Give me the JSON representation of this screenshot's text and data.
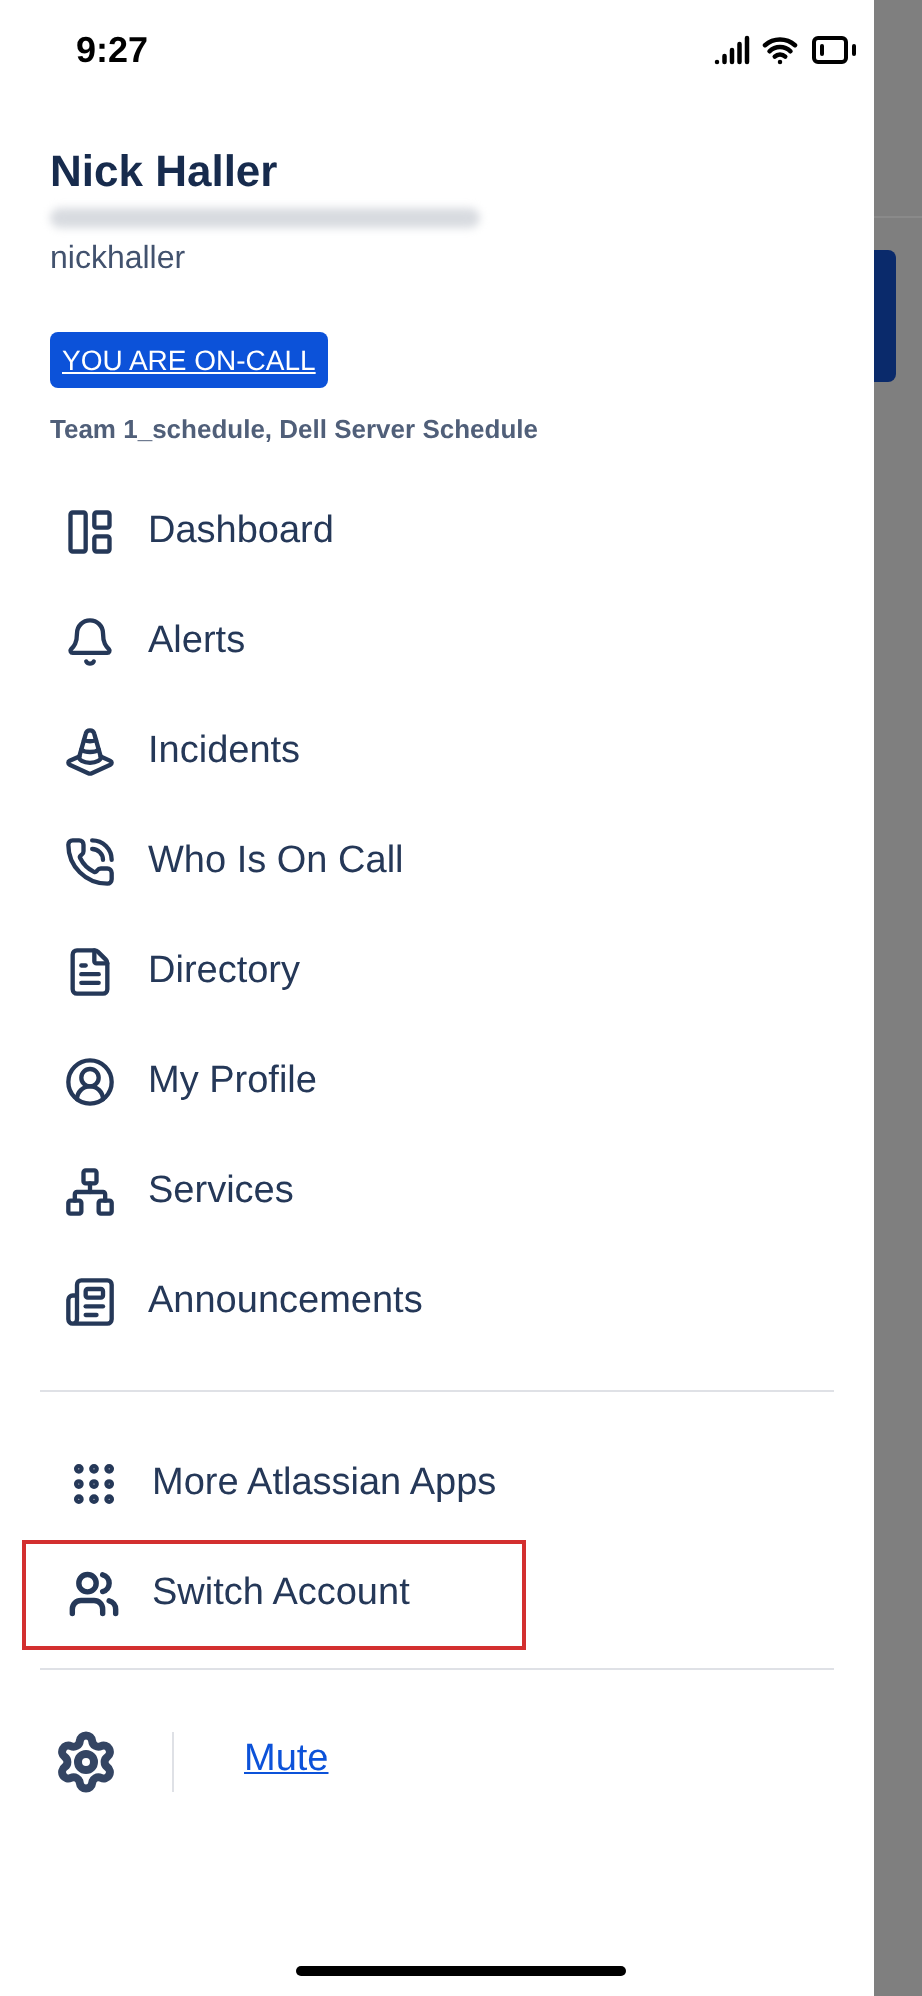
{
  "status_bar": {
    "time": "9:27"
  },
  "profile": {
    "name": "Nick Haller",
    "username": "nickhaller",
    "on_call_badge": "YOU ARE ON-CALL",
    "schedules": "Team 1_schedule, Dell Server Schedule"
  },
  "menu": [
    {
      "label": "Dashboard"
    },
    {
      "label": "Alerts"
    },
    {
      "label": "Incidents"
    },
    {
      "label": "Who Is On Call"
    },
    {
      "label": "Directory"
    },
    {
      "label": "My Profile"
    },
    {
      "label": "Services"
    },
    {
      "label": "Announcements"
    }
  ],
  "secondary_menu": [
    {
      "label": "More Atlassian Apps",
      "highlighted": false
    },
    {
      "label": "Switch Account",
      "highlighted": true
    }
  ],
  "footer": {
    "mute_link": "Mute"
  }
}
